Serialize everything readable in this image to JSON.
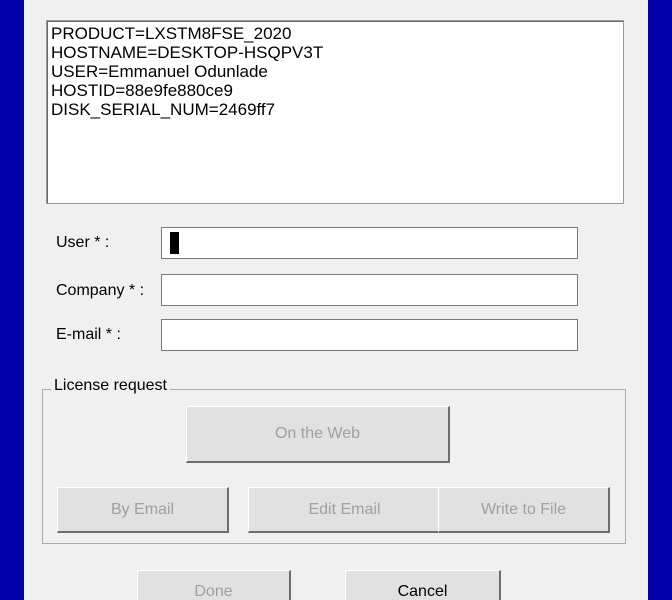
{
  "info_box": {
    "lines": [
      "PRODUCT=LXSTM8FSE_2020",
      "HOSTNAME=DESKTOP-HSQPV3T",
      "USER=Emmanuel Odunlade",
      "HOSTID=88e9fe880ce9",
      "DISK_SERIAL_NUM=2469ff7"
    ]
  },
  "form": {
    "user_label": "User * :",
    "user_value": "",
    "company_label": "Company * :",
    "company_value": "",
    "email_label": "E-mail * :",
    "email_value": ""
  },
  "license_request": {
    "title": "License request",
    "on_the_web": "On the Web",
    "by_email": "By Email",
    "edit_email": "Edit Email",
    "write_to_file": "Write to File"
  },
  "footer": {
    "done": "Done",
    "cancel": "Cancel"
  }
}
